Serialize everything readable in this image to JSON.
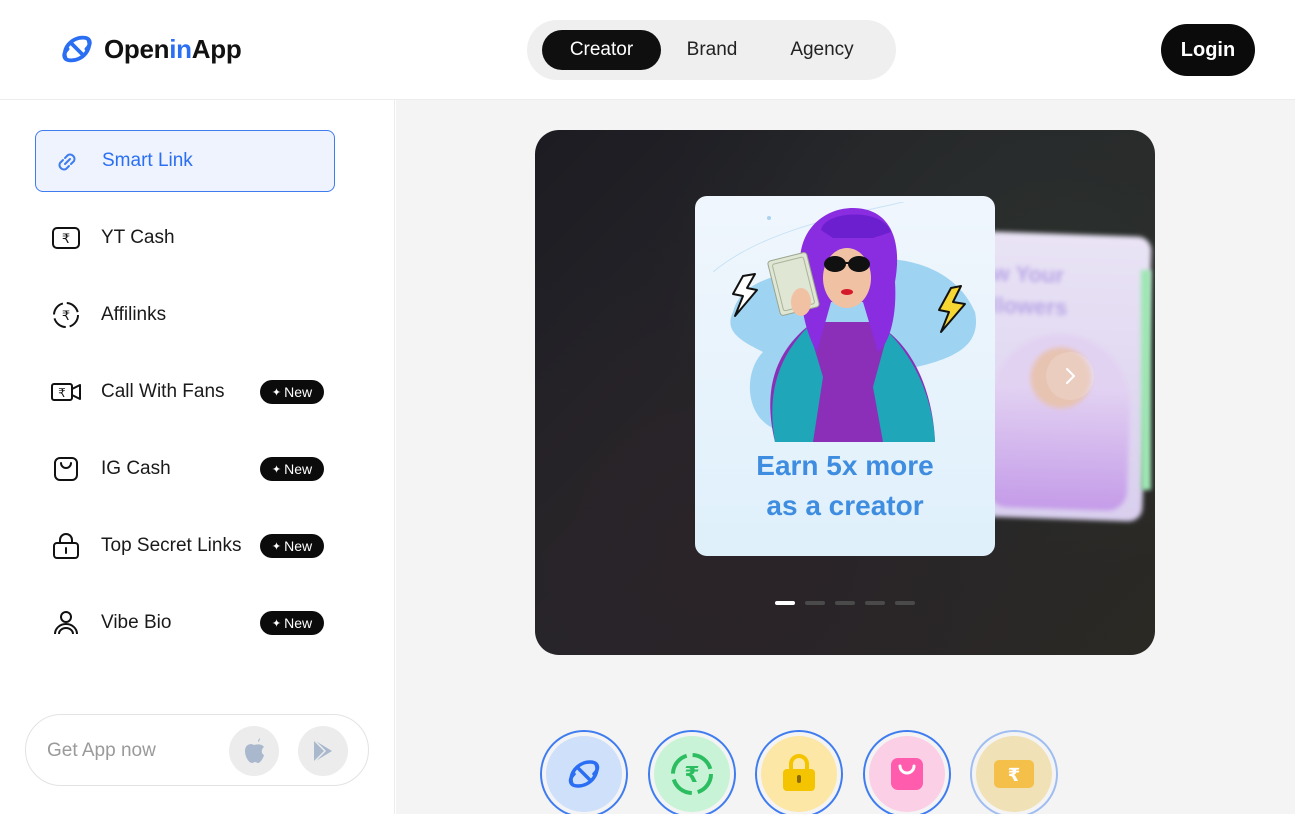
{
  "brand": {
    "name_prefix": "Open",
    "name_accent": "in",
    "name_suffix": "App"
  },
  "header": {
    "tabs": [
      {
        "label": "Creator",
        "active": true
      },
      {
        "label": "Brand",
        "active": false
      },
      {
        "label": "Agency",
        "active": false
      }
    ],
    "login_label": "Login"
  },
  "sidebar": {
    "items": [
      {
        "label": "Smart Link",
        "icon": "link-icon",
        "active": true,
        "badge": ""
      },
      {
        "label": "YT Cash",
        "icon": "rupee-card-icon",
        "active": false,
        "badge": ""
      },
      {
        "label": "Affilinks",
        "icon": "rupee-circle-icon",
        "active": false,
        "badge": ""
      },
      {
        "label": "Call With Fans",
        "icon": "video-rupee-icon",
        "active": false,
        "badge": "New"
      },
      {
        "label": "IG Cash",
        "icon": "bag-icon",
        "active": false,
        "badge": "New"
      },
      {
        "label": "Top Secret Links",
        "icon": "lock-icon",
        "active": false,
        "badge": "New"
      },
      {
        "label": "Vibe Bio",
        "icon": "person-icon",
        "active": false,
        "badge": "New"
      }
    ],
    "get_app": {
      "label": "Get App now",
      "stores": [
        "apple-icon",
        "play-store-icon"
      ]
    }
  },
  "hero": {
    "card_text_line1": "Earn 5x more",
    "card_text_line2": "as a creator",
    "back_card_text_line1": "w Your",
    "back_card_text_line2": "llowers",
    "slide_count": 5,
    "active_slide": 1
  },
  "products": [
    {
      "icon": "openinapp-icon",
      "color": "#cfe0fb"
    },
    {
      "icon": "rupee-circle-icon",
      "color": "#c9f3d6"
    },
    {
      "icon": "lock-icon",
      "color": "#fde7a6"
    },
    {
      "icon": "bag-icon",
      "color": "#fbd0e6"
    },
    {
      "icon": "rupee-card-icon",
      "color": "#f1e1b6"
    }
  ],
  "colors": {
    "accent": "#2a6ff3",
    "dark": "#0b0b0b",
    "card_text": "#3f8de0"
  }
}
